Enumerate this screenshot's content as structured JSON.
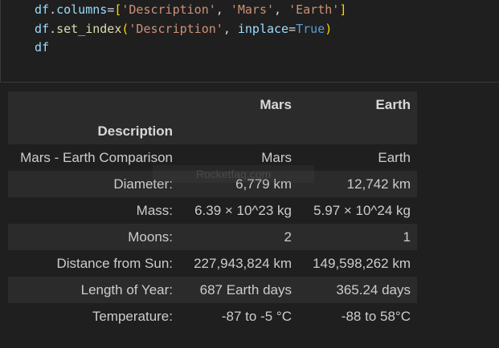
{
  "code": {
    "lines": [
      {
        "parts": [
          [
            "var",
            "df"
          ],
          [
            "op",
            "."
          ],
          [
            "var",
            "columns"
          ],
          [
            "op",
            "="
          ],
          [
            "punc",
            "["
          ],
          [
            "str",
            "'Description'"
          ],
          [
            "op",
            ", "
          ],
          [
            "str",
            "'Mars'"
          ],
          [
            "op",
            ", "
          ],
          [
            "str",
            "'Earth'"
          ],
          [
            "punc",
            "]"
          ]
        ]
      },
      {
        "parts": [
          [
            "var",
            "df"
          ],
          [
            "op",
            "."
          ],
          [
            "fn",
            "set_index"
          ],
          [
            "punc",
            "("
          ],
          [
            "str",
            "'Description'"
          ],
          [
            "op",
            ", "
          ],
          [
            "var",
            "inplace"
          ],
          [
            "op",
            "="
          ],
          [
            "kw",
            "True"
          ],
          [
            "punc",
            ")"
          ]
        ]
      },
      {
        "parts": [
          [
            "var",
            "df"
          ]
        ]
      }
    ]
  },
  "table": {
    "columns": [
      "Mars",
      "Earth"
    ],
    "index_name": "Description",
    "rows": [
      {
        "label": "Mars - Earth Comparison",
        "mars": "Mars",
        "earth": "Earth"
      },
      {
        "label": "Diameter:",
        "mars": "6,779 km",
        "earth": "12,742 km"
      },
      {
        "label": "Mass:",
        "mars": "6.39 × 10^23 kg",
        "earth": "5.97 × 10^24 kg"
      },
      {
        "label": "Moons:",
        "mars": "2",
        "earth": "1"
      },
      {
        "label": "Distance from Sun:",
        "mars": "227,943,824 km",
        "earth": "149,598,262 km"
      },
      {
        "label": "Length of Year:",
        "mars": "687 Earth days",
        "earth": "365.24 days"
      },
      {
        "label": "Temperature:",
        "mars": "-87 to -5 °C",
        "earth": "-88 to 58°C"
      }
    ]
  },
  "watermark": "Rocketfaq.com"
}
